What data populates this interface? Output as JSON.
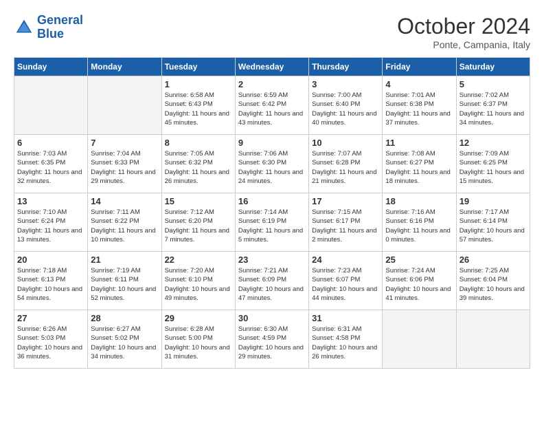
{
  "logo": {
    "line1": "General",
    "line2": "Blue"
  },
  "title": "October 2024",
  "subtitle": "Ponte, Campania, Italy",
  "headers": [
    "Sunday",
    "Monday",
    "Tuesday",
    "Wednesday",
    "Thursday",
    "Friday",
    "Saturday"
  ],
  "weeks": [
    [
      {
        "day": "",
        "empty": true
      },
      {
        "day": "",
        "empty": true
      },
      {
        "day": "1",
        "sunrise": "Sunrise: 6:58 AM",
        "sunset": "Sunset: 6:43 PM",
        "daylight": "Daylight: 11 hours and 45 minutes."
      },
      {
        "day": "2",
        "sunrise": "Sunrise: 6:59 AM",
        "sunset": "Sunset: 6:42 PM",
        "daylight": "Daylight: 11 hours and 43 minutes."
      },
      {
        "day": "3",
        "sunrise": "Sunrise: 7:00 AM",
        "sunset": "Sunset: 6:40 PM",
        "daylight": "Daylight: 11 hours and 40 minutes."
      },
      {
        "day": "4",
        "sunrise": "Sunrise: 7:01 AM",
        "sunset": "Sunset: 6:38 PM",
        "daylight": "Daylight: 11 hours and 37 minutes."
      },
      {
        "day": "5",
        "sunrise": "Sunrise: 7:02 AM",
        "sunset": "Sunset: 6:37 PM",
        "daylight": "Daylight: 11 hours and 34 minutes."
      }
    ],
    [
      {
        "day": "6",
        "sunrise": "Sunrise: 7:03 AM",
        "sunset": "Sunset: 6:35 PM",
        "daylight": "Daylight: 11 hours and 32 minutes."
      },
      {
        "day": "7",
        "sunrise": "Sunrise: 7:04 AM",
        "sunset": "Sunset: 6:33 PM",
        "daylight": "Daylight: 11 hours and 29 minutes."
      },
      {
        "day": "8",
        "sunrise": "Sunrise: 7:05 AM",
        "sunset": "Sunset: 6:32 PM",
        "daylight": "Daylight: 11 hours and 26 minutes."
      },
      {
        "day": "9",
        "sunrise": "Sunrise: 7:06 AM",
        "sunset": "Sunset: 6:30 PM",
        "daylight": "Daylight: 11 hours and 24 minutes."
      },
      {
        "day": "10",
        "sunrise": "Sunrise: 7:07 AM",
        "sunset": "Sunset: 6:28 PM",
        "daylight": "Daylight: 11 hours and 21 minutes."
      },
      {
        "day": "11",
        "sunrise": "Sunrise: 7:08 AM",
        "sunset": "Sunset: 6:27 PM",
        "daylight": "Daylight: 11 hours and 18 minutes."
      },
      {
        "day": "12",
        "sunrise": "Sunrise: 7:09 AM",
        "sunset": "Sunset: 6:25 PM",
        "daylight": "Daylight: 11 hours and 15 minutes."
      }
    ],
    [
      {
        "day": "13",
        "sunrise": "Sunrise: 7:10 AM",
        "sunset": "Sunset: 6:24 PM",
        "daylight": "Daylight: 11 hours and 13 minutes."
      },
      {
        "day": "14",
        "sunrise": "Sunrise: 7:11 AM",
        "sunset": "Sunset: 6:22 PM",
        "daylight": "Daylight: 11 hours and 10 minutes."
      },
      {
        "day": "15",
        "sunrise": "Sunrise: 7:12 AM",
        "sunset": "Sunset: 6:20 PM",
        "daylight": "Daylight: 11 hours and 7 minutes."
      },
      {
        "day": "16",
        "sunrise": "Sunrise: 7:14 AM",
        "sunset": "Sunset: 6:19 PM",
        "daylight": "Daylight: 11 hours and 5 minutes."
      },
      {
        "day": "17",
        "sunrise": "Sunrise: 7:15 AM",
        "sunset": "Sunset: 6:17 PM",
        "daylight": "Daylight: 11 hours and 2 minutes."
      },
      {
        "day": "18",
        "sunrise": "Sunrise: 7:16 AM",
        "sunset": "Sunset: 6:16 PM",
        "daylight": "Daylight: 11 hours and 0 minutes."
      },
      {
        "day": "19",
        "sunrise": "Sunrise: 7:17 AM",
        "sunset": "Sunset: 6:14 PM",
        "daylight": "Daylight: 10 hours and 57 minutes."
      }
    ],
    [
      {
        "day": "20",
        "sunrise": "Sunrise: 7:18 AM",
        "sunset": "Sunset: 6:13 PM",
        "daylight": "Daylight: 10 hours and 54 minutes."
      },
      {
        "day": "21",
        "sunrise": "Sunrise: 7:19 AM",
        "sunset": "Sunset: 6:11 PM",
        "daylight": "Daylight: 10 hours and 52 minutes."
      },
      {
        "day": "22",
        "sunrise": "Sunrise: 7:20 AM",
        "sunset": "Sunset: 6:10 PM",
        "daylight": "Daylight: 10 hours and 49 minutes."
      },
      {
        "day": "23",
        "sunrise": "Sunrise: 7:21 AM",
        "sunset": "Sunset: 6:09 PM",
        "daylight": "Daylight: 10 hours and 47 minutes."
      },
      {
        "day": "24",
        "sunrise": "Sunrise: 7:23 AM",
        "sunset": "Sunset: 6:07 PM",
        "daylight": "Daylight: 10 hours and 44 minutes."
      },
      {
        "day": "25",
        "sunrise": "Sunrise: 7:24 AM",
        "sunset": "Sunset: 6:06 PM",
        "daylight": "Daylight: 10 hours and 41 minutes."
      },
      {
        "day": "26",
        "sunrise": "Sunrise: 7:25 AM",
        "sunset": "Sunset: 6:04 PM",
        "daylight": "Daylight: 10 hours and 39 minutes."
      }
    ],
    [
      {
        "day": "27",
        "sunrise": "Sunrise: 6:26 AM",
        "sunset": "Sunset: 5:03 PM",
        "daylight": "Daylight: 10 hours and 36 minutes."
      },
      {
        "day": "28",
        "sunrise": "Sunrise: 6:27 AM",
        "sunset": "Sunset: 5:02 PM",
        "daylight": "Daylight: 10 hours and 34 minutes."
      },
      {
        "day": "29",
        "sunrise": "Sunrise: 6:28 AM",
        "sunset": "Sunset: 5:00 PM",
        "daylight": "Daylight: 10 hours and 31 minutes."
      },
      {
        "day": "30",
        "sunrise": "Sunrise: 6:30 AM",
        "sunset": "Sunset: 4:59 PM",
        "daylight": "Daylight: 10 hours and 29 minutes."
      },
      {
        "day": "31",
        "sunrise": "Sunrise: 6:31 AM",
        "sunset": "Sunset: 4:58 PM",
        "daylight": "Daylight: 10 hours and 26 minutes."
      },
      {
        "day": "",
        "empty": true
      },
      {
        "day": "",
        "empty": true
      }
    ]
  ]
}
